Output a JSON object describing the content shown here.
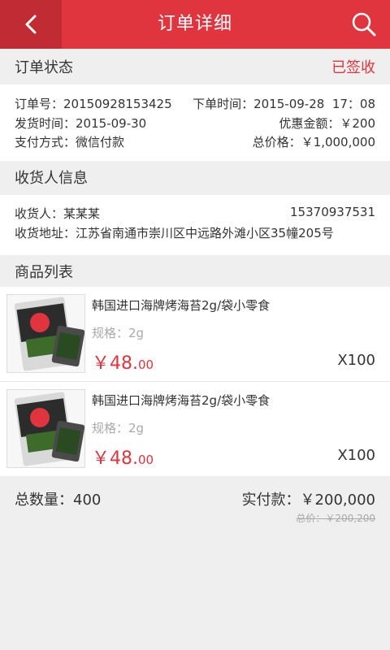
{
  "header": {
    "title": "订单详细"
  },
  "order_status": {
    "heading": "订单状态",
    "status": "已签收"
  },
  "order_info": {
    "order_no_label": "订单号：",
    "order_no": "20150928153425",
    "order_time_label": "下单时间：",
    "order_time": "2015-09-28  17：08",
    "ship_time_label": "发货时间：",
    "ship_time": "2015-09-30",
    "discount_label": "优惠金额：",
    "discount": "￥200",
    "pay_method_label": "支付方式：",
    "pay_method": "微信付款",
    "total_label": "总价格：",
    "total": "￥1,000,000"
  },
  "receiver": {
    "heading": "收货人信息",
    "name_label": "收货人：",
    "name": "某某某",
    "phone": "15370937531",
    "address_label": "收货地址：",
    "address": "江苏省南通市崇川区中远路外滩小区35幢205号"
  },
  "goods_list": {
    "heading": "商品列表",
    "items": [
      {
        "name": "韩国进口海牌烤海苔2g/袋小零食",
        "spec": "规格：2g",
        "price_int": "￥48.",
        "price_dec": "00",
        "qty": "X100"
      },
      {
        "name": "韩国进口海牌烤海苔2g/袋小零食",
        "spec": "规格：2g",
        "price_int": "￥48.",
        "price_dec": "00",
        "qty": "X100"
      }
    ]
  },
  "summary": {
    "total_qty": "总数量：400",
    "paid": "实付款：￥200,000",
    "original": "总价：￥200,200"
  },
  "colors": {
    "accent": "#e0353f",
    "accent_dark": "#c12b33"
  }
}
